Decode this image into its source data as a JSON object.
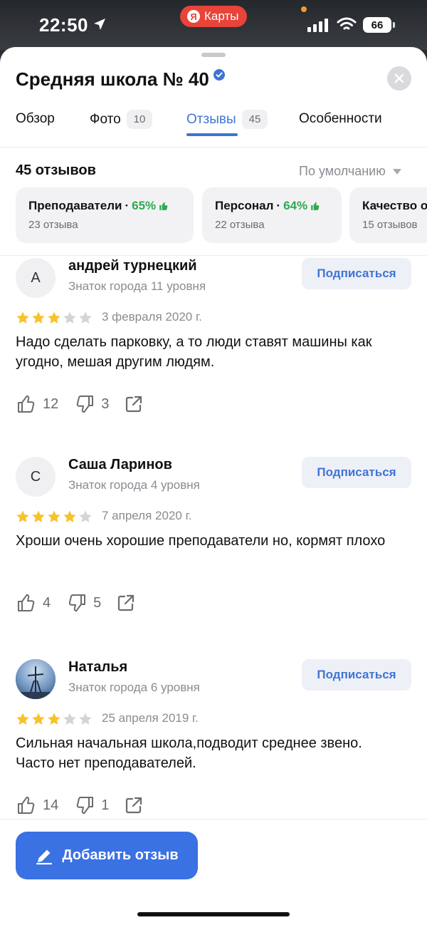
{
  "status_bar": {
    "time": "22:50",
    "app_pill": "Карты",
    "app_logo": "Я",
    "battery": "66"
  },
  "header": {
    "title": "Средняя школа № 40"
  },
  "tabs": [
    {
      "label": "Обзор",
      "count": ""
    },
    {
      "label": "Фото",
      "count": "10"
    },
    {
      "label": "Отзывы",
      "count": "45"
    },
    {
      "label": "Особенности",
      "count": ""
    }
  ],
  "reviews_summary": {
    "count_label": "45 отзывов",
    "sort_label": "По умолчанию"
  },
  "chips": [
    {
      "title": "Преподаватели",
      "dot": " · ",
      "percent": "65%",
      "sub": "23 отзыва"
    },
    {
      "title": "Персонал",
      "dot": " · ",
      "percent": "64%",
      "sub": "22 отзыва"
    },
    {
      "title": "Качество о",
      "dot": "",
      "percent": "",
      "sub": "15 отзывов"
    }
  ],
  "reviews": [
    {
      "avatar_letter": "А",
      "name": "андрей турнецкий",
      "level": "Знаток города 11 уровня",
      "subscribe": "Подписаться",
      "rating": 3,
      "date": "3 февраля 2020 г.",
      "text": "Надо сделать парковку, а то люди ставят машины как угодно, мешая другим людям.",
      "likes": "12",
      "dislikes": "3"
    },
    {
      "avatar_letter": "С",
      "name": "Саша Ларинов",
      "level": "Знаток города 4 уровня",
      "subscribe": "Подписаться",
      "rating": 4,
      "date": "7 апреля 2020 г.",
      "text": "Хроши очень хорошие преподаватели но, кормят плохо",
      "likes": "4",
      "dislikes": "5"
    },
    {
      "avatar_letter": "",
      "name": "Наталья",
      "level": "Знаток города 6 уровня",
      "subscribe": "Подписаться",
      "rating": 3,
      "date": "25 апреля 2019 г.",
      "text": "Сильная начальная школа,подводит среднее звено. Часто нет преподавателей.",
      "likes": "14",
      "dislikes": "1"
    }
  ],
  "footer": {
    "add_review": "Добавить отзыв"
  },
  "colors": {
    "accent": "#3f74d6",
    "star": "#f5c42c",
    "positive": "#2fa84f"
  }
}
